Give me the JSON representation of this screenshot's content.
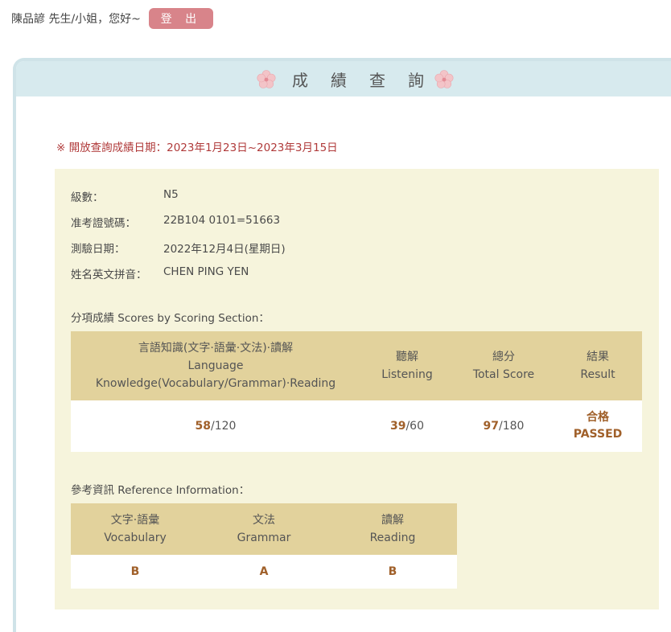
{
  "header": {
    "greeting": "陳品諺 先生/小姐，您好~",
    "logout_label": "登 出"
  },
  "panel": {
    "title": "成績查詢",
    "notice": "※ 開放查詢成績日期：2023年1月23日~2023年3月15日"
  },
  "candidate": {
    "level_label": "級數：",
    "level": "N5",
    "id_label": "准考證號碼：",
    "id": "22B104 0101=51663",
    "date_label": "測驗日期：",
    "date": "2022年12月4日(星期日)",
    "name_label": "姓名英文拼音：",
    "name": "CHEN PING YEN"
  },
  "scores": {
    "section_label": "分項成績 Scores by Scoring Section：",
    "headers": {
      "language_zh": "言語知識(文字·語彙·文法)·讀解",
      "language_en1": "Language",
      "language_en2": "Knowledge(Vocabulary/Grammar)·Reading",
      "listening_zh": "聽解",
      "listening_en": "Listening",
      "total_zh": "總分",
      "total_en": "Total Score",
      "result_zh": "結果",
      "result_en": "Result"
    },
    "language_score": "58",
    "language_max": "/120",
    "listening_score": "39",
    "listening_max": "/60",
    "total_score": "97",
    "total_max": "/180",
    "result_zh": "合格",
    "result_en": "PASSED"
  },
  "reference": {
    "section_label": "參考資訊 Reference Information：",
    "headers": {
      "vocab_zh": "文字·語彙",
      "vocab_en": "Vocabulary",
      "grammar_zh": "文法",
      "grammar_en": "Grammar",
      "reading_zh": "讀解",
      "reading_en": "Reading"
    },
    "vocabulary": "B",
    "grammar": "A",
    "reading": "B"
  }
}
